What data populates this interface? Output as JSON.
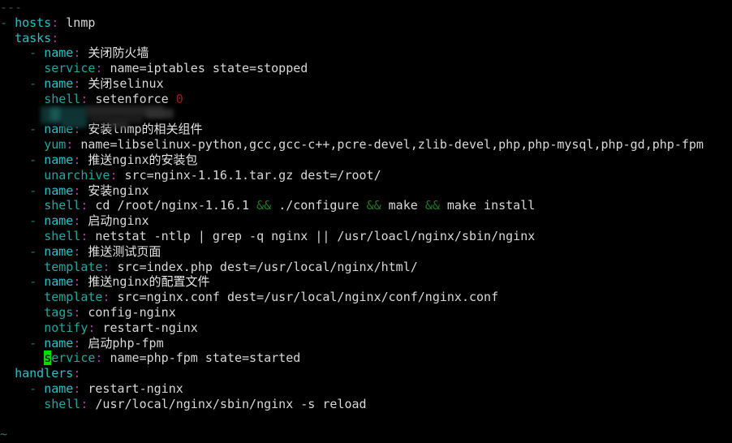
{
  "terminal": {
    "title": "vim-ansible-playbook",
    "background": "#000000",
    "foreground": "#d0d0d0",
    "cursor_color": "#00e000",
    "font_size_px": 15,
    "cols": 94,
    "rows": 29
  },
  "colors": {
    "comment_dim": "#44474a",
    "key_cyan": "#25c2c9",
    "key_teal": "#1fa8a0",
    "punct_magenta": "#a83fa8",
    "value_white": "#d8d8d8",
    "number_red": "#a31a1a",
    "operator_green": "#1e7a1e",
    "dash_teal": "#1f7a6a",
    "cursor_green": "#00e000"
  },
  "lines": [
    {
      "id": "l01",
      "text": "---"
    },
    {
      "id": "l02",
      "text": "- hosts: lnmp"
    },
    {
      "id": "l03",
      "text": "  tasks:"
    },
    {
      "id": "l04",
      "text": "    - name: 关闭防火墙"
    },
    {
      "id": "l05",
      "text": "      service: name=iptables state=stopped"
    },
    {
      "id": "l06",
      "text": "    - name: 关闭selinux"
    },
    {
      "id": "l07",
      "text": "      shell: setenforce 0"
    },
    {
      "id": "l08",
      "text": "REDACTED"
    },
    {
      "id": "l09",
      "text": "    - name: 安装lnmp的相关组件"
    },
    {
      "id": "l10",
      "text": "      yum: name=libselinux-python,gcc,gcc-c++,pcre-devel,zlib-devel,php,php-mysql,php-gd,php-fpm"
    },
    {
      "id": "l11",
      "text": "    - name: 推送nginx的安装包"
    },
    {
      "id": "l12",
      "text": "      unarchive: src=nginx-1.16.1.tar.gz dest=/root/"
    },
    {
      "id": "l13",
      "text": "    - name: 安装nginx"
    },
    {
      "id": "l14",
      "text": "      shell: cd /root/nginx-1.16.1 && ./configure && make && make install"
    },
    {
      "id": "l15",
      "text": "    - name: 启动nginx"
    },
    {
      "id": "l16",
      "text": "      shell: netstat -ntlp | grep -q nginx || /usr/loacl/nginx/sbin/nginx"
    },
    {
      "id": "l17",
      "text": "    - name: 推送测试页面"
    },
    {
      "id": "l18",
      "text": "      template: src=index.php dest=/usr/local/nginx/html/"
    },
    {
      "id": "l19",
      "text": "    - name: 推送nginx的配置文件"
    },
    {
      "id": "l20",
      "text": "      template: src=nginx.conf dest=/usr/local/nginx/conf/nginx.conf"
    },
    {
      "id": "l21",
      "text": "      tags: config-nginx"
    },
    {
      "id": "l22",
      "text": "      notify: restart-nginx"
    },
    {
      "id": "l23",
      "text": "    - name: 启动php-fpm"
    },
    {
      "id": "l24",
      "text": "      service: name=php-fpm state=started"
    },
    {
      "id": "l25",
      "text": "  handlers:"
    },
    {
      "id": "l26",
      "text": "    - name: restart-nginx"
    },
    {
      "id": "l27",
      "text": "      shell: /usr/local/nginx/sbin/nginx -s reload"
    },
    {
      "id": "l28",
      "text": ""
    },
    {
      "id": "l29",
      "text": "~"
    }
  ],
  "tokens": {
    "doc_start": "---",
    "dash": "-",
    "colon": ":",
    "keys": {
      "hosts": "hosts",
      "tasks": "tasks",
      "name": "name",
      "service": "service",
      "shell": "shell",
      "yum": "yum",
      "unarchive": "unarchive",
      "template": "template",
      "tags": "tags",
      "notify": "notify",
      "handlers": "handlers"
    },
    "values": {
      "lnmp": "lnmp",
      "iptables_stopped": "name=iptables state=stopped",
      "setenforce": "setenforce",
      "zero": "0",
      "yum_packages": "name=libselinux-python,gcc,gcc-c++,pcre-devel,zlib-devel,php,php-mysql,php-gd,php-fpm",
      "unarchive_args": "src=nginx-1.16.1.tar.gz dest=/root/",
      "build_cd": "cd /root/nginx-1.16.1",
      "build_configure": "./configure",
      "build_make": "make",
      "build_make_install": "make install",
      "and_and": "&&",
      "netstat_cmd": "netstat -ntlp | grep -q nginx || /usr/loacl/nginx/sbin/nginx",
      "tpl_index": "src=index.php dest=/usr/local/nginx/html/",
      "tpl_conf": "src=nginx.conf dest=/usr/local/nginx/conf/nginx.conf",
      "tag_config_nginx": "config-nginx",
      "notify_restart_nginx": "restart-nginx",
      "phpfpm_started": "name=php-fpm state=started",
      "handler_name": "restart-nginx",
      "handler_shell": "/usr/local/nginx/sbin/nginx -s reload",
      "tilde": "~"
    },
    "cjk": {
      "close_firewall": "关闭防火墙",
      "close_selinux_prefix": "关闭",
      "selinux": "selinux",
      "install_lnmp_components_a": "安装",
      "install_lnmp_components_b": "lnmp",
      "install_lnmp_components_c": "的相关组件",
      "push_nginx_pkg_a": "推送",
      "push_nginx_pkg_b": "nginx",
      "push_nginx_pkg_c": "的安装包",
      "install_nginx_a": "安装",
      "install_nginx_b": "nginx",
      "start_nginx_a": "启动",
      "start_nginx_b": "nginx",
      "push_test_page": "推送测试页面",
      "push_nginx_conf_a": "推送",
      "push_nginx_conf_b": "nginx",
      "push_nginx_conf_c": "的配置文件",
      "start_phpfpm_a": "启动",
      "start_phpfpm_b": "php-fpm"
    }
  },
  "cursor": {
    "char": "s",
    "rest_of_word": "ervice",
    "line_id": "l24",
    "column": 7
  },
  "redacted": {
    "present": true,
    "label": "blurred-redacted-line",
    "line_id": "l08"
  }
}
